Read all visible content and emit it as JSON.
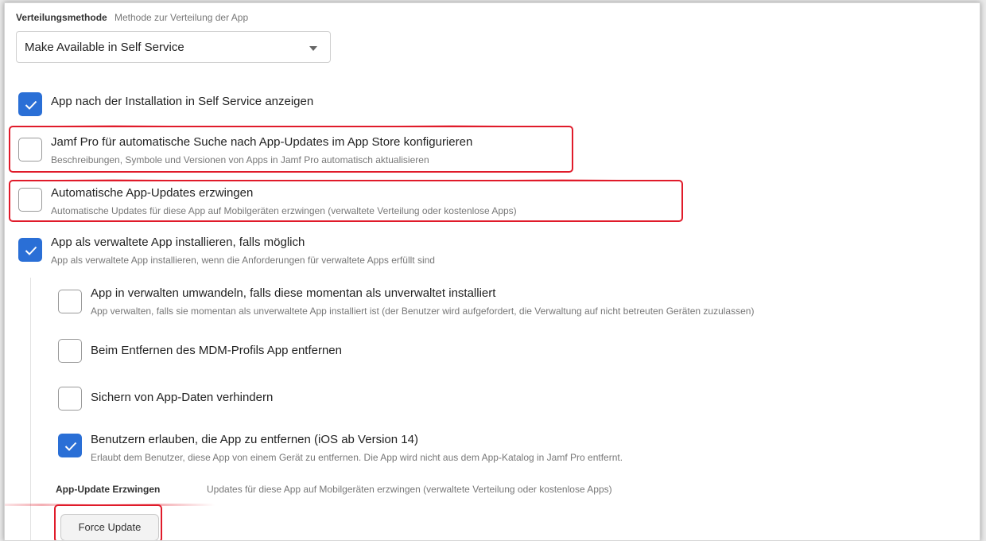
{
  "distribution": {
    "label": "Verteilungsmethode",
    "description": "Methode zur Verteilung der App",
    "selected": "Make Available in Self Service"
  },
  "options": {
    "show_after_install": {
      "title": "App nach der Installation in Self Service anzeigen",
      "checked": true
    },
    "auto_update_search": {
      "title": "Jamf Pro für automatische Suche nach App-Updates im App Store konfigurieren",
      "desc": "Beschreibungen, Symbole und Versionen von Apps in Jamf Pro automatisch aktualisieren",
      "checked": false
    },
    "force_auto_updates": {
      "title": "Automatische App-Updates erzwingen",
      "desc": "Automatische Updates für diese App auf Mobilgeräten erzwingen (verwaltete Verteilung oder kostenlose Apps)",
      "checked": false
    },
    "install_managed": {
      "title": "App als verwaltete App installieren, falls möglich",
      "desc": "App als verwaltete App installieren, wenn die Anforderungen für verwaltete Apps erfüllt sind",
      "checked": true
    },
    "convert_to_managed": {
      "title": "App in verwalten umwandeln, falls diese momentan als unverwaltet installiert",
      "desc": "App verwalten, falls sie momentan als unverwaltete App installiert ist (der Benutzer wird aufgefordert, die Verwaltung auf nicht betreuten Geräten zuzulassen)",
      "checked": false
    },
    "remove_with_mdm": {
      "title": "Beim Entfernen des MDM-Profils App entfernen",
      "checked": false
    },
    "prevent_backup": {
      "title": "Sichern von App-Daten verhindern",
      "checked": false
    },
    "allow_user_remove": {
      "title": "Benutzern erlauben, die App zu entfernen (iOS ab Version 14)",
      "desc": "Erlaubt dem Benutzer, diese App von einem Gerät zu entfernen. Die App wird nicht aus dem App-Katalog in Jamf Pro entfernt.",
      "checked": true
    }
  },
  "force_update": {
    "label": "App-Update Erzwingen",
    "description": "Updates für diese App auf Mobilgeräten erzwingen (verwaltete Verteilung oder kostenlose Apps)",
    "button": "Force Update"
  },
  "colors": {
    "accent": "#2a6fd6",
    "highlight": "#e01b2a"
  },
  "icons": {
    "checkmark": "check-icon",
    "dropdown": "chevron-down-icon"
  }
}
